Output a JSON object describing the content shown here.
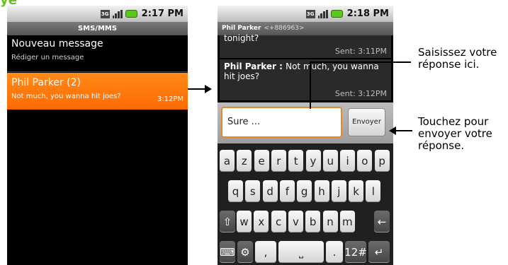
{
  "top_fragment": "yé",
  "phone1": {
    "status_time": "2:17 PM",
    "title": "SMS/MMS",
    "new_message": {
      "title": "Nouveau message",
      "subtitle": "Rédiger un message"
    },
    "thread": {
      "name": "Phil Parker  (2)",
      "snippet": "Not much, you wanna hit joes?",
      "time": "3:12PM"
    }
  },
  "phone2": {
    "status_time": "2:18 PM",
    "title": "Phil Parker",
    "number": "<+886963>",
    "messages": [
      {
        "text": "tonight?",
        "sent": "Sent: 3:11PM"
      },
      {
        "sender": "Phil Parker : ",
        "text": "Not much, you wanna hit joes?",
        "sent": "Sent: 3:12PM"
      }
    ],
    "input_value": "Sure ...",
    "send_label": "Envoyer",
    "keyboard": {
      "row1": [
        "a",
        "z",
        "e",
        "r",
        "t",
        "y",
        "u",
        "i",
        "o",
        "p"
      ],
      "row2": [
        "q",
        "s",
        "d",
        "f",
        "g",
        "h",
        "j",
        "k",
        "l"
      ],
      "row3": [
        "⇧",
        "w",
        "x",
        "c",
        "v",
        "b",
        "n",
        "m",
        "←"
      ],
      "row4": [
        "⌨",
        "⚙",
        ",",
        "⎵",
        ".",
        "12#",
        "↵"
      ]
    }
  },
  "callouts": {
    "reply_here": "Saisissez votre réponse ici.",
    "send_reply": "Touchez pour envoyer votre réponse."
  },
  "icons": {
    "network": "3g-icon",
    "signal": "signal-icon",
    "battery": "battery-icon"
  }
}
